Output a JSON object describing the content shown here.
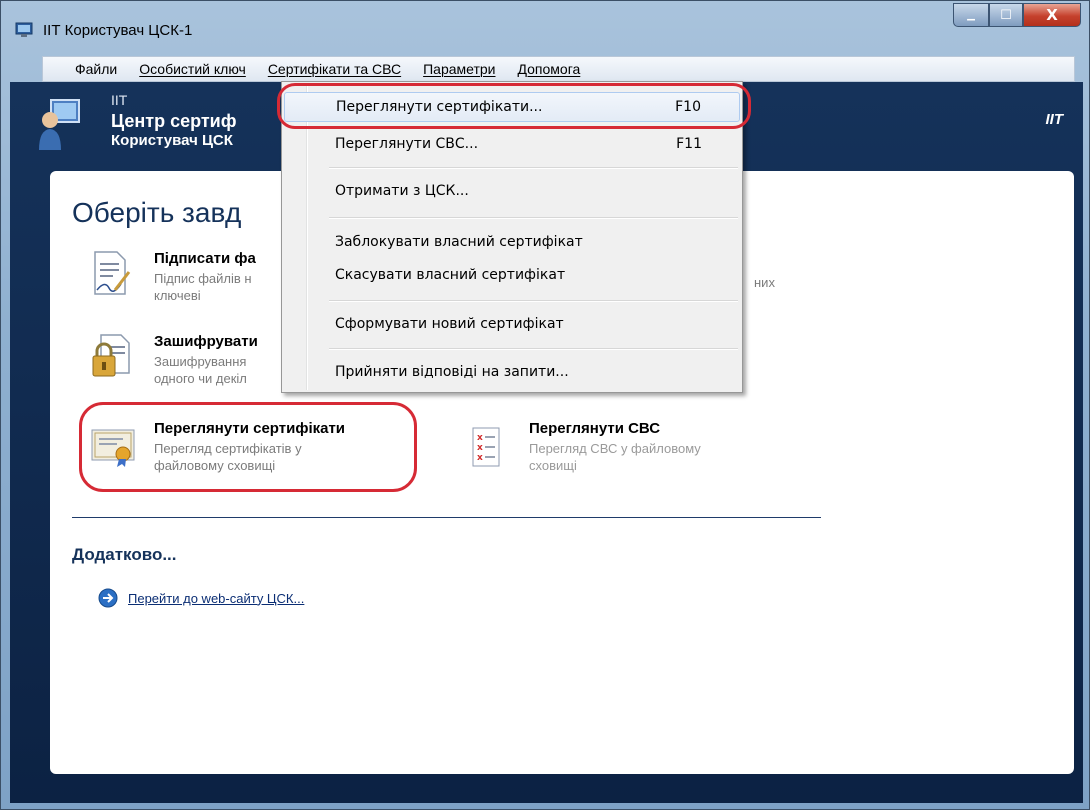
{
  "window": {
    "title": "ІІТ Користувач ЦСК-1",
    "controls": {
      "minimize": "▁",
      "maximize": "☐",
      "close": "X"
    }
  },
  "menubar": {
    "items": [
      "Файли",
      "Особистий ключ",
      "Сертифікати та СВС",
      "Параметри",
      "Допомога"
    ]
  },
  "header": {
    "org_short": "ІІТ",
    "center": "Центр сертиф",
    "user": "Користувач ЦСК",
    "brand": "IIT"
  },
  "main": {
    "title": "Оберіть завд",
    "tasks": [
      {
        "name": "Підписати фа",
        "desc1": "Підпис файлів н",
        "desc2": "ключеві",
        "icon": "sign-document-icon"
      },
      {
        "name": "Зашифрувати",
        "desc1": "Зашифрування",
        "desc2": "одного чи декіл",
        "icon": "lock-document-icon"
      },
      {
        "name": "Переглянути сертифікати",
        "desc1": "Перегляд сертифікатів у",
        "desc2": "файловому сховищі",
        "icon": "certificate-icon"
      },
      {
        "name": "Переглянути СВС",
        "desc1": "Перегляд СВС у файловому",
        "desc2": "сховищі",
        "icon": "revocation-list-icon"
      }
    ],
    "hidden_fragment": "них",
    "extra": {
      "title": "Додатково...",
      "link": "Перейти до web-сайту ЦСК..."
    }
  },
  "dropdown": {
    "items": [
      {
        "label": "Переглянути сертифікати...",
        "shortcut": "F10"
      },
      {
        "label": "Переглянути СВС...",
        "shortcut": "F11"
      },
      {
        "label": "Отримати з ЦСК...",
        "shortcut": ""
      },
      {
        "label": "Заблокувати власний сертифікат",
        "shortcut": ""
      },
      {
        "label": "Скасувати власний сертифікат",
        "shortcut": ""
      },
      {
        "label": "Сформувати новий сертифікат",
        "shortcut": ""
      },
      {
        "label": "Прийняти відповіді на запити...",
        "shortcut": ""
      }
    ]
  },
  "colors": {
    "header_bg": "#15325a",
    "annotation": "#d62a35",
    "link": "#0b2e74"
  }
}
